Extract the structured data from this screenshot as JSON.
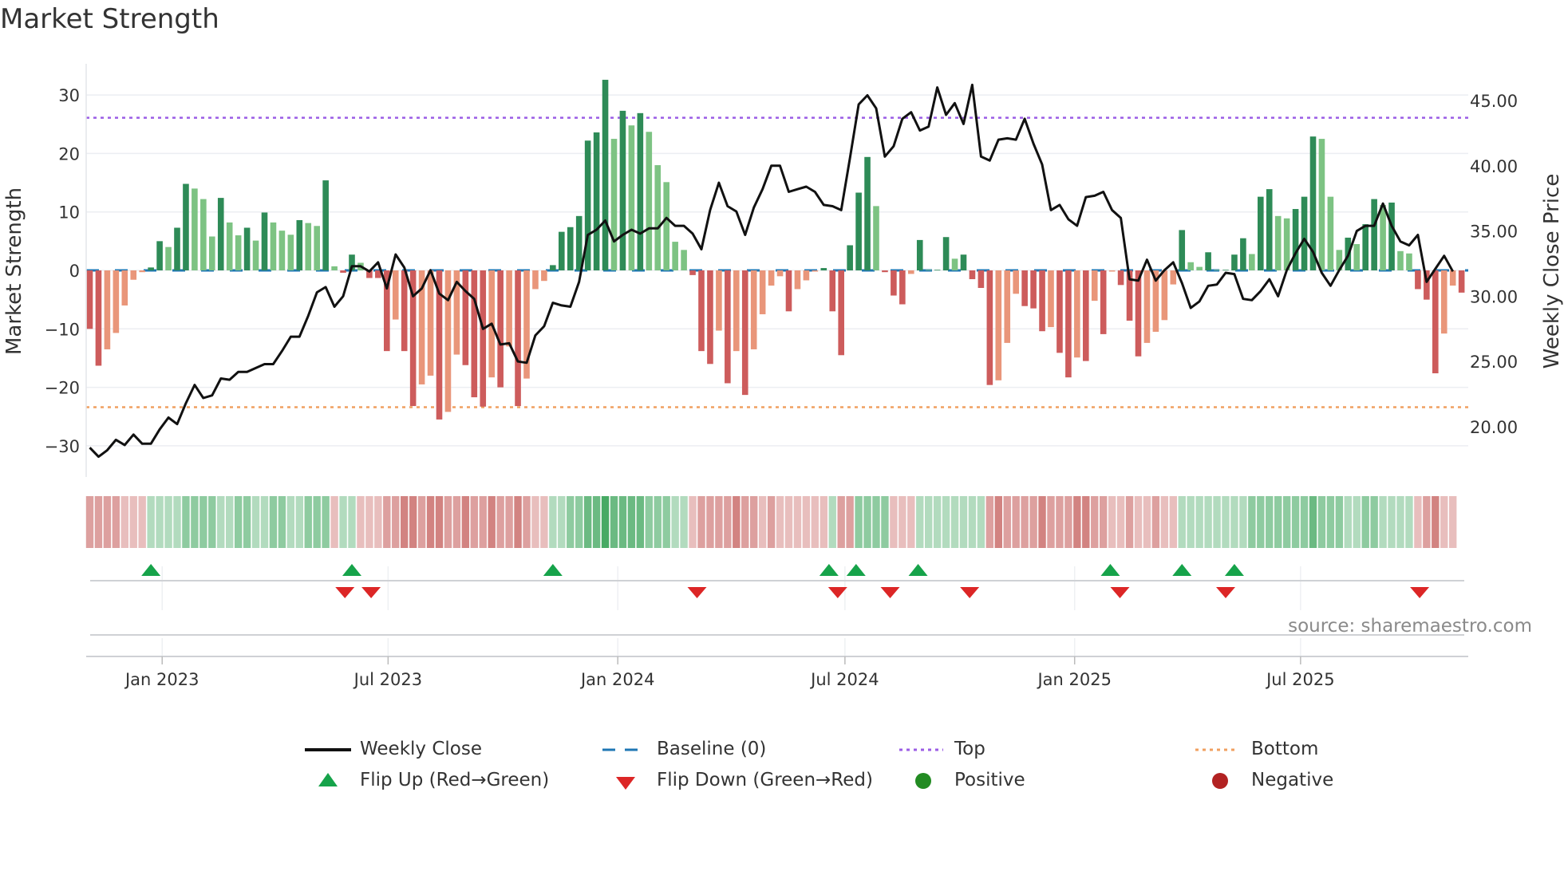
{
  "title": "Market Strength",
  "source": "source: sharemaestro.com",
  "legend": {
    "weekly_close": "Weekly Close",
    "baseline": "Baseline (0)",
    "top": "Top",
    "bottom": "Bottom",
    "flip_up": "Flip Up (Red→Green)",
    "flip_down": "Flip Down (Green→Red)",
    "positive": "Positive",
    "negative": "Negative"
  },
  "colors": {
    "strong_green": "#2e8b57",
    "weak_green": "#7dc383",
    "strong_red": "#cd5c5c",
    "weak_red": "#e9967a",
    "close": "#111111",
    "baseline": "#1f77b4",
    "top": "#9b5de5",
    "bottom": "#f0a060",
    "heat_green": "#2e9e4f",
    "heat_red": "#c0504d",
    "flip_up": "#16a34a",
    "flip_down": "#dc2626",
    "positive": "#228b22",
    "negative": "#b22222"
  },
  "chart_data": {
    "type": "bar+line",
    "title": "Market Strength",
    "ylabel": "Market Strength",
    "y2label": "Weekly Close Price",
    "ylim": [
      -34,
      35
    ],
    "y2lim": [
      17,
      47
    ],
    "yticks": [
      30,
      20,
      10,
      0,
      -10,
      -20,
      -30
    ],
    "y2ticks": [
      "45.00",
      "40.00",
      "35.00",
      "30.00",
      "25.00",
      "20.00"
    ],
    "start_date": "2022-11-04",
    "frequency": "weekly",
    "xticks": [
      {
        "label": "Jan 2023",
        "date": "2023-01-01"
      },
      {
        "label": "Jul 2023",
        "date": "2023-07-01"
      },
      {
        "label": "Jan 2024",
        "date": "2024-01-01"
      },
      {
        "label": "Jul 2024",
        "date": "2024-07-01"
      },
      {
        "label": "Jan 2025",
        "date": "2025-01-01"
      },
      {
        "label": "Jul 2025",
        "date": "2025-07-01"
      }
    ],
    "top": 26.1,
    "bottom": -23.4,
    "baseline": 0,
    "strength": [
      -10,
      -16.3,
      -13.5,
      -10.7,
      -6,
      -1.6,
      -0.3,
      0.5,
      5,
      4,
      7.3,
      14.8,
      14,
      12.2,
      5.8,
      12.4,
      8.2,
      6,
      7.3,
      5.1,
      9.9,
      8.2,
      6.8,
      6.1,
      8.6,
      8.1,
      7.6,
      15.4,
      0.7,
      -0.4,
      2.7,
      1.3,
      -1.3,
      -1.3,
      -13.8,
      -8.4,
      -13.8,
      -23.2,
      -19.5,
      -18,
      -25.5,
      -24.2,
      -14.4,
      -16.2,
      -21.7,
      -23.3,
      -18.3,
      -20,
      -13,
      -23.2,
      -18.5,
      -3.2,
      -1.8,
      0.9,
      6.6,
      7.4,
      9.3,
      22.2,
      23.6,
      32.6,
      22.5,
      27.3,
      24.8,
      26.9,
      23.7,
      18,
      15.1,
      4.9,
      3.5,
      -0.8,
      -13.8,
      -16,
      -10.3,
      -19.3,
      -13.8,
      -21.3,
      -13.5,
      -7.5,
      -2.6,
      -1,
      -7,
      -3.2,
      -1.7,
      -0.2,
      0.4,
      -7,
      -14.5,
      4.3,
      13.3,
      19.4,
      11,
      -0.3,
      -4.3,
      -5.8,
      -0.6,
      5.2,
      0.1,
      0.1,
      5.7,
      2,
      2.7,
      -1.5,
      -3,
      -19.6,
      -18.8,
      -12.4,
      -4,
      -6.1,
      -6.5,
      -10.4,
      -9.7,
      -14.1,
      -18.3,
      -14.9,
      -15.5,
      -5.2,
      -10.9,
      -0.2,
      -2.5,
      -8.6,
      -14.7,
      -12.4,
      -10.5,
      -8.5,
      -2.4,
      6.9,
      1.4,
      0.6,
      3.1,
      0.1,
      0.1,
      2.7,
      5.5,
      2.8,
      12.6,
      13.9,
      9.3,
      8.9,
      10.5,
      12.6,
      22.9,
      22.5,
      12.6,
      3.5,
      5.6,
      4.5,
      7.9,
      12.2,
      11.2,
      11.6,
      3.3,
      2.9,
      -3.2,
      -5,
      -17.6,
      -10.8,
      -2.6,
      -3.8
    ],
    "weekly_close": [
      18.4,
      17.7,
      18.2,
      19.0,
      18.6,
      19.4,
      18.7,
      18.7,
      19.8,
      20.7,
      20.2,
      21.8,
      23.2,
      22.2,
      22.4,
      23.7,
      23.6,
      24.2,
      24.2,
      24.5,
      24.8,
      24.8,
      25.8,
      26.9,
      26.9,
      28.5,
      30.3,
      30.7,
      29.2,
      30.0,
      32.3,
      32.3,
      31.9,
      32.6,
      30.6,
      33.2,
      32.2,
      30.0,
      30.6,
      32.0,
      30.2,
      29.7,
      31.1,
      30.4,
      29.8,
      27.5,
      27.9,
      26.3,
      26.4,
      25.0,
      24.9,
      27.0,
      27.7,
      29.5,
      29.3,
      29.2,
      31.1,
      34.7,
      35.1,
      35.8,
      34.2,
      34.7,
      35.1,
      34.8,
      35.2,
      35.2,
      36.0,
      35.4,
      35.4,
      34.8,
      33.6,
      36.6,
      38.7,
      36.9,
      36.5,
      34.7,
      36.8,
      38.2,
      40.0,
      40.0,
      38.0,
      38.2,
      38.4,
      38.0,
      37.0,
      36.9,
      36.6,
      40.6,
      44.7,
      45.4,
      44.4,
      40.7,
      41.5,
      43.6,
      44.1,
      42.7,
      43.0,
      46.0,
      43.9,
      44.8,
      43.2,
      46.2,
      40.7,
      40.4,
      42.0,
      42.1,
      42.0,
      43.6,
      41.7,
      40.1,
      36.6,
      37.0,
      35.9,
      35.4,
      37.6,
      37.7,
      38.0,
      36.6,
      36.0,
      31.3,
      31.2,
      32.8,
      31.2,
      32.0,
      32.6,
      31.0,
      29.1,
      29.6,
      30.8,
      30.9,
      31.8,
      31.7,
      29.8,
      29.7,
      30.4,
      31.3,
      30.0,
      32.0,
      33.3,
      34.4,
      33.4,
      31.8,
      30.8,
      32.0,
      33.1,
      35.0,
      35.4,
      35.4,
      37.1,
      35.4,
      34.2,
      33.9,
      34.7,
      31.1,
      32.1,
      33.1,
      31.9
    ],
    "regime_heat": [
      -2,
      -2,
      -2,
      -2,
      -1,
      -1,
      -1,
      1,
      1,
      1,
      1,
      2,
      2,
      2,
      2,
      1,
      1,
      2,
      2,
      1,
      1,
      2,
      2,
      1,
      1,
      2,
      2,
      2,
      -1,
      1,
      1,
      -1,
      -1,
      -1,
      -2,
      -2,
      -3,
      -3,
      -2,
      -3,
      -3,
      -2,
      -2,
      -3,
      -2,
      -2,
      -3,
      -2,
      -2,
      -3,
      -2,
      -1,
      -1,
      1,
      1,
      2,
      2,
      3,
      3,
      4,
      3,
      3,
      3,
      3,
      2,
      2,
      2,
      1,
      1,
      -1,
      -2,
      -2,
      -2,
      -2,
      -3,
      -2,
      -2,
      -1,
      -2,
      -1,
      -1,
      -1,
      -1,
      -1,
      -1,
      1,
      -2,
      -2,
      2,
      2,
      2,
      2,
      -1,
      -1,
      -1,
      1,
      1,
      1,
      1,
      1,
      1,
      1,
      1,
      -2,
      -3,
      -2,
      -2,
      -2,
      -2,
      -3,
      -2,
      -2,
      -2,
      -3,
      -3,
      -2,
      -2,
      -1,
      -1,
      -2,
      -1,
      -1,
      -2,
      -1,
      -1,
      1,
      1,
      1,
      1,
      1,
      1,
      1,
      1,
      2,
      2,
      2,
      2,
      2,
      2,
      2,
      3,
      2,
      2,
      2,
      1,
      1,
      2,
      2,
      1,
      1,
      1,
      1,
      -1,
      -2,
      -3,
      -1,
      -1
    ],
    "flip_up_weeks": [
      7,
      30,
      53,
      84.6,
      87.7,
      94.8,
      116.8,
      125,
      131
    ],
    "flip_down_weeks": [
      29.2,
      32.2,
      69.5,
      85.6,
      91.6,
      100.7,
      117.9,
      130,
      152.2
    ],
    "grid": true,
    "legend_position": "bottom"
  }
}
